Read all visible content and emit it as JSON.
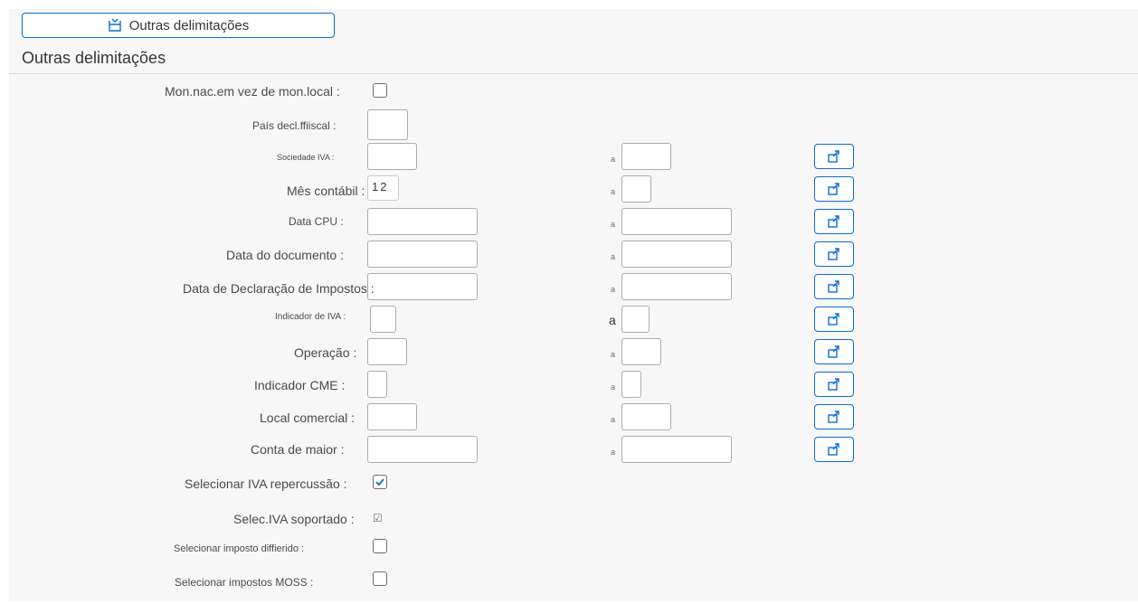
{
  "top_button": {
    "label": "Outras delimitações",
    "icon": "screen-select-icon"
  },
  "section_title": "Outras delimitações",
  "to_label": "a",
  "fields": {
    "mon_nac": {
      "label": "Mon.nac.em vez de mon.local :",
      "checked": false
    },
    "pais": {
      "label": "País  decl.ffiiscal :",
      "value": ""
    },
    "sociedade": {
      "label": "Sociedade IVA :",
      "from": "",
      "to": ""
    },
    "mes": {
      "label": "Mês contábil :",
      "from": "12",
      "to": ""
    },
    "data_cpu": {
      "label": "Data CPU :",
      "from": "",
      "to": ""
    },
    "data_doc": {
      "label": "Data do documento :",
      "from": "",
      "to": ""
    },
    "data_decl": {
      "label": "Data de Declaração de Impostos :",
      "from": "",
      "to": ""
    },
    "ind_iva": {
      "label": "Indicador de IVA :",
      "from": "",
      "to": ""
    },
    "operacao": {
      "label": "Operação :",
      "from": "",
      "to": ""
    },
    "ind_cme": {
      "label": "Indicador  CME :",
      "from": "",
      "to": ""
    },
    "local": {
      "label": "Local comercial :",
      "from": "",
      "to": ""
    },
    "conta": {
      "label": "Conta de maior :",
      "from": "",
      "to": ""
    },
    "sel_rep": {
      "label": "Selecionar IVA repercussão :",
      "checked": true
    },
    "sel_sup": {
      "label": "Selec.IVA  soportado :",
      "checked": true
    },
    "sel_dif": {
      "label": "Selecionar imposto diffierido :",
      "checked": false
    },
    "sel_moss": {
      "label": "Selecionar impostos MOSS :",
      "checked": false
    }
  },
  "colors": {
    "accent": "#0a6ed1",
    "background": "#f7f7f7",
    "text": "#32363a"
  }
}
